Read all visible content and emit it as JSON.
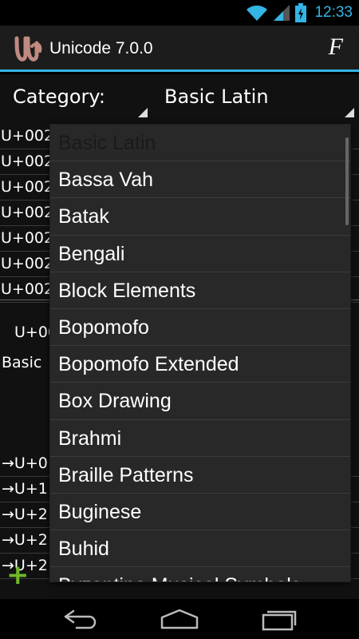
{
  "status": {
    "time": "12:33"
  },
  "appbar": {
    "title": "Unicode 7.0.0",
    "font_button": "F"
  },
  "spinner": {
    "label": "Category:",
    "value": "Basic Latin"
  },
  "code_list": [
    "U+002",
    "U+002",
    "U+002",
    "U+002",
    "U+002",
    "U+002",
    "U+002"
  ],
  "detail": {
    "code": "U+00",
    "block": "Basic"
  },
  "related_list": [
    "→U+0",
    "→U+1",
    "→U+2",
    "→U+2",
    "→U+2"
  ],
  "add_button": "+",
  "dropdown": {
    "items": [
      "Basic Latin",
      "Bassa Vah",
      "Batak",
      "Bengali",
      "Block Elements",
      "Bopomofo",
      "Bopomofo Extended",
      "Box Drawing",
      "Brahmi",
      "Braille Patterns",
      "Buginese",
      "Buhid",
      "Byzantine Musical Symbols"
    ],
    "selected_index": 0
  },
  "colors": {
    "accent": "#33b5e5",
    "add": "#6fb82a",
    "dropdown_bg": "#282828"
  },
  "icons": {
    "wifi": "wifi-icon",
    "signal": "signal-icon",
    "battery": "battery-icon",
    "app": "app-icon",
    "back": "back-icon",
    "home": "home-icon",
    "recent": "recent-apps-icon"
  }
}
